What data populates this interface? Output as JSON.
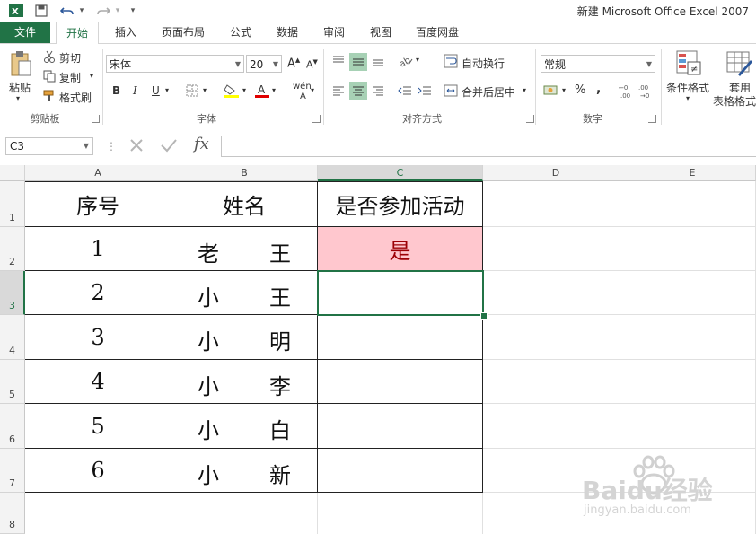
{
  "window": {
    "title": "新建 Microsoft Office Excel 2007"
  },
  "quick_access": {
    "undo_arrow": "▾",
    "redo_arrow": "▾",
    "customize": "▾"
  },
  "tabs": [
    "文件",
    "开始",
    "插入",
    "页面布局",
    "公式",
    "数据",
    "审阅",
    "视图",
    "百度网盘"
  ],
  "ribbon": {
    "clipboard": {
      "paste": "粘贴",
      "cut": "剪切",
      "copy": "复制",
      "format_painter": "格式刷",
      "label": "剪贴板"
    },
    "font": {
      "family": "宋体",
      "size": "20",
      "grow": "A",
      "shrink": "A",
      "bold": "B",
      "italic": "I",
      "underline": "U",
      "phonetic": "wén",
      "label": "字体"
    },
    "alignment": {
      "wrap_text": "自动换行",
      "merge_center": "合并后居中",
      "label": "对齐方式"
    },
    "number": {
      "format": "常规",
      "percent": "%",
      "comma": ",",
      "label": "数字"
    },
    "styles": {
      "conditional": "条件格式",
      "table_line1": "套用",
      "table_line2": "表格格式"
    }
  },
  "formula_bar": {
    "name_box": "C3",
    "fx": "fx",
    "value": ""
  },
  "sheet": {
    "columns": [
      "A",
      "B",
      "C",
      "D",
      "E"
    ],
    "rows": [
      "1",
      "2",
      "3",
      "4",
      "5",
      "6",
      "7",
      "8"
    ],
    "headers": [
      "序号",
      "姓名",
      "是否参加活动"
    ],
    "data": [
      {
        "no": "1",
        "surname": "老",
        "given": "王",
        "join": "是"
      },
      {
        "no": "2",
        "surname": "小",
        "given": "王",
        "join": ""
      },
      {
        "no": "3",
        "surname": "小",
        "given": "明",
        "join": ""
      },
      {
        "no": "4",
        "surname": "小",
        "given": "李",
        "join": ""
      },
      {
        "no": "5",
        "surname": "小",
        "given": "白",
        "join": ""
      },
      {
        "no": "6",
        "surname": "小",
        "given": "新",
        "join": ""
      }
    ],
    "selected_cell": "C3",
    "highlight_color": "#ffc7ce",
    "highlight_text_color": "#9c0006",
    "accent_color": "#217346"
  },
  "watermark": {
    "brand": "Baidu经验",
    "url": "jingyan.baidu.com"
  }
}
